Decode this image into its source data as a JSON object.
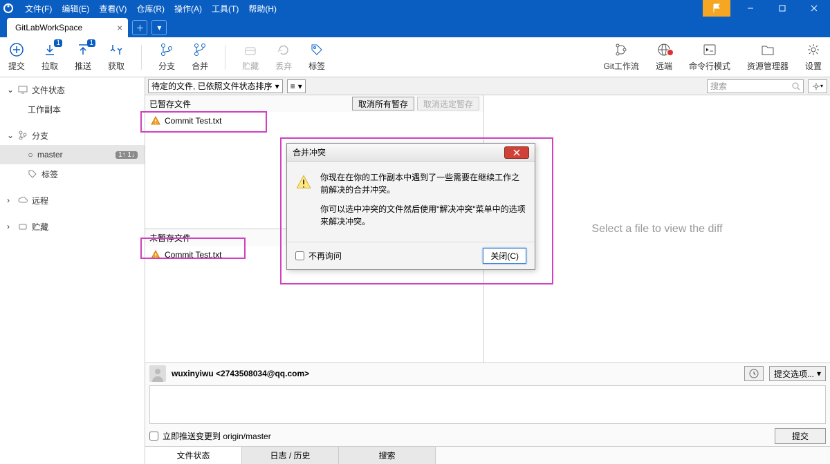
{
  "menu": {
    "file": "文件(F)",
    "edit": "编辑(E)",
    "view": "查看(V)",
    "repo": "仓库(R)",
    "action": "操作(A)",
    "tool": "工具(T)",
    "help": "帮助(H)"
  },
  "tab": {
    "name": "GitLabWorkSpace"
  },
  "toolbar": {
    "commit": "提交",
    "pull": "拉取",
    "push": "推送",
    "fetch": "获取",
    "branch": "分支",
    "merge": "合并",
    "stash": "贮藏",
    "discard": "丢弃",
    "tag": "标签",
    "gitflow": "Git工作流",
    "remote": "远端",
    "cmd": "命令行模式",
    "explorer": "资源管理器",
    "settings": "设置",
    "pull_badge": "1",
    "push_badge": "1"
  },
  "sidebar": {
    "filestatus": "文件状态",
    "workcopy": "工作副本",
    "branch": "分支",
    "master": "master",
    "master_badge": "1↑ 1↓",
    "tag": "标签",
    "remote": "远程",
    "stash": "贮藏"
  },
  "filter": {
    "sort": "待定的文件, 已依照文件状态排序",
    "search_ph": "搜索"
  },
  "stage": {
    "staged_hdr": "已暂存文件",
    "unstaged_hdr": "未暂存文件",
    "unstage_all": "取消所有暂存",
    "unstage_sel": "取消选定暂存",
    "file": "Commit Test.txt",
    "diff_ph": "Select a file to view the diff"
  },
  "commit": {
    "author": "wuxinyiwu <2743508034@qq.com>",
    "options": "提交选项...",
    "push_now": "立即推送变更到 origin/master",
    "submit": "提交"
  },
  "btabs": {
    "status": "文件状态",
    "log": "日志 / 历史",
    "search": "搜索"
  },
  "dialog": {
    "title": "合并冲突",
    "l1": "你现在在你的工作副本中遇到了一些需要在继续工作之前解决的合并冲突。",
    "l2": "你可以选中冲突的文件然后使用\"解决冲突\"菜单中的选项来解决冲突。",
    "no_ask": "不再询问",
    "close": "关闭(C)"
  }
}
